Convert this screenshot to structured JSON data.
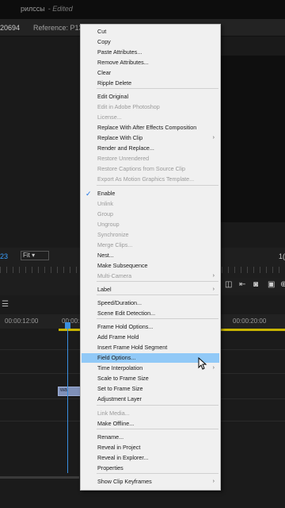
{
  "header": {
    "sequence_name": "рилссы",
    "edited_label": "- Edited",
    "timecode_left": "20694",
    "reference_label": "Reference: P132069"
  },
  "monitor": {
    "timecode": "23",
    "fit_label": "Fit",
    "right_value": "1("
  },
  "timeline": {
    "ruler_ticks": [
      "00:00:12:00",
      "00:00:14",
      "00:00:20:00"
    ],
    "clip_label": "wa"
  },
  "context_menu": {
    "items": [
      {
        "label": "Cut",
        "disabled": false
      },
      {
        "label": "Copy",
        "disabled": false
      },
      {
        "label": "Paste Attributes...",
        "disabled": false
      },
      {
        "label": "Remove Attributes...",
        "disabled": false
      },
      {
        "label": "Clear",
        "disabled": false
      },
      {
        "label": "Ripple Delete",
        "disabled": false
      },
      {
        "label": "Edit Original",
        "disabled": false
      },
      {
        "label": "Edit in Adobe Photoshop",
        "disabled": true
      },
      {
        "label": "License...",
        "disabled": true
      },
      {
        "label": "Replace With After Effects Composition",
        "disabled": false
      },
      {
        "label": "Replace With Clip",
        "disabled": false,
        "submenu": true
      },
      {
        "label": "Render and Replace...",
        "disabled": false
      },
      {
        "label": "Restore Unrendered",
        "disabled": true
      },
      {
        "label": "Restore Captions from Source Clip",
        "disabled": true
      },
      {
        "label": "Export As Motion Graphics Template...",
        "disabled": true
      },
      {
        "label": "Enable",
        "disabled": false,
        "checked": true
      },
      {
        "label": "Unlink",
        "disabled": true
      },
      {
        "label": "Group",
        "disabled": true
      },
      {
        "label": "Ungroup",
        "disabled": true
      },
      {
        "label": "Synchronize",
        "disabled": true
      },
      {
        "label": "Merge Clips...",
        "disabled": true
      },
      {
        "label": "Nest...",
        "disabled": false
      },
      {
        "label": "Make Subsequence",
        "disabled": false
      },
      {
        "label": "Multi-Camera",
        "disabled": true,
        "submenu": true
      },
      {
        "label": "Label",
        "disabled": false,
        "submenu": true
      },
      {
        "label": "Speed/Duration...",
        "disabled": false
      },
      {
        "label": "Scene Edit Detection...",
        "disabled": false
      },
      {
        "label": "Frame Hold Options...",
        "disabled": false
      },
      {
        "label": "Add Frame Hold",
        "disabled": false
      },
      {
        "label": "Insert Frame Hold Segment",
        "disabled": false
      },
      {
        "label": "Field Options...",
        "disabled": false,
        "highlighted": true
      },
      {
        "label": "Time Interpolation",
        "disabled": false,
        "submenu": true
      },
      {
        "label": "Scale to Frame Size",
        "disabled": false
      },
      {
        "label": "Set to Frame Size",
        "disabled": false
      },
      {
        "label": "Adjustment Layer",
        "disabled": false
      },
      {
        "label": "Link Media...",
        "disabled": true
      },
      {
        "label": "Make Offline...",
        "disabled": false
      },
      {
        "label": "Rename...",
        "disabled": false
      },
      {
        "label": "Reveal in Project",
        "disabled": false
      },
      {
        "label": "Reveal in Explorer...",
        "disabled": false
      },
      {
        "label": "Properties",
        "disabled": false
      },
      {
        "label": "Show Clip Keyframes",
        "disabled": false,
        "submenu": true
      }
    ]
  },
  "colors": {
    "highlight": "#91c9f7",
    "menu_bg": "#f0f0f0",
    "accent_blue": "#3aa0ff",
    "work_area": "#c8b400"
  }
}
